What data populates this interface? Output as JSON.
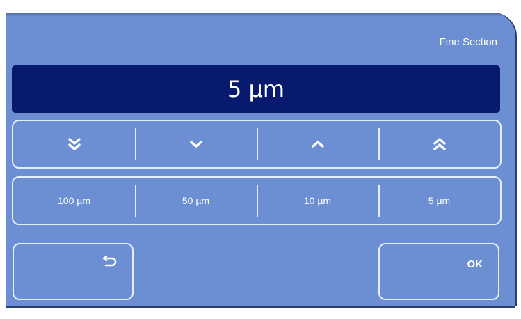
{
  "dialog": {
    "title": "Fine Section",
    "display_value": "5 µm"
  },
  "arrow_buttons": [
    {
      "name": "fast-down",
      "icon": "double-chevron-down-icon"
    },
    {
      "name": "down",
      "icon": "chevron-down-icon"
    },
    {
      "name": "up",
      "icon": "chevron-up-icon"
    },
    {
      "name": "fast-up",
      "icon": "double-chevron-up-icon"
    }
  ],
  "step_buttons": [
    {
      "label": "100 µm"
    },
    {
      "label": "50 µm"
    },
    {
      "label": "10 µm"
    },
    {
      "label": "5 µm"
    }
  ],
  "footer": {
    "back_icon": "return-arrow-icon",
    "ok_label": "OK"
  },
  "colors": {
    "panel": "#6b8fd2",
    "display_bg": "#071a6e",
    "outline": "#e7eefb",
    "text": "#ffffff"
  }
}
